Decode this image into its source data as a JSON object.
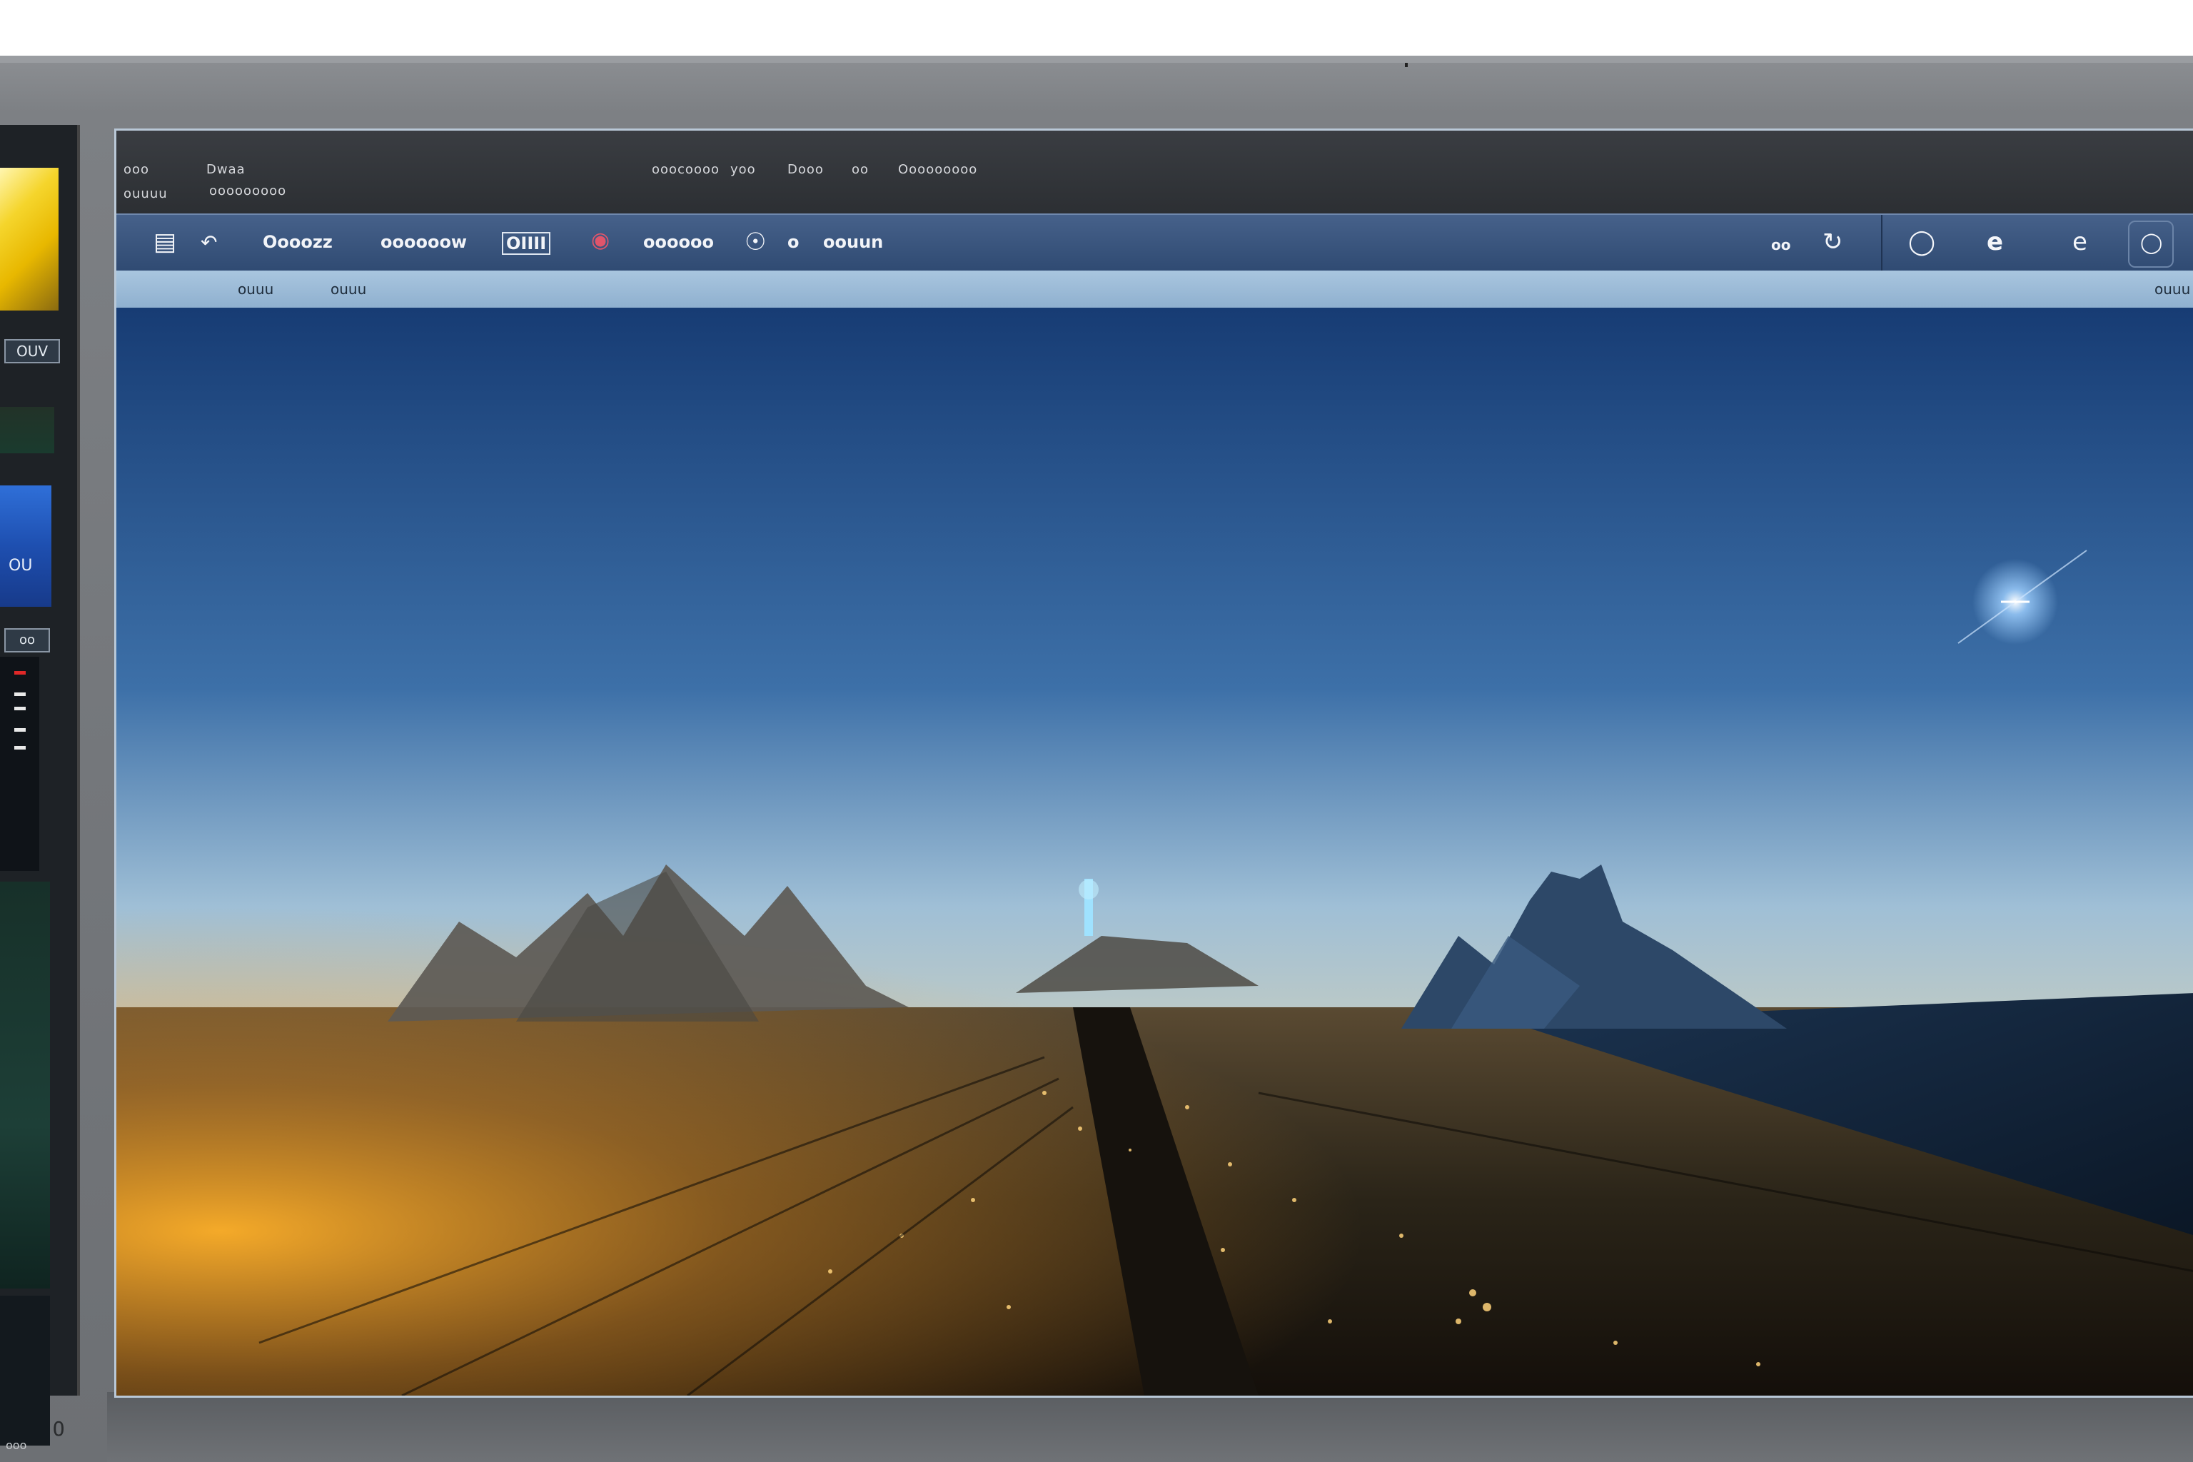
{
  "menubar": {
    "items": [
      "ooo",
      "Dwaa",
      "ouuuu",
      "ooooooooo",
      "ooocoooo",
      "yoo",
      "Dooo",
      "oo",
      "Ooooooooo"
    ]
  },
  "toolbar": {
    "items": [
      "Oooozz",
      "oooooow",
      "OIIII",
      "oooooo",
      "o",
      "oouun"
    ],
    "right_label": "oo",
    "icons": [
      "grid-icon",
      "back-icon",
      "record-icon",
      "location-pin-icon",
      "refresh-icon",
      "circle-icon",
      "e-icon",
      "e-icon",
      "circle-icon"
    ]
  },
  "subbar": {
    "items": [
      "ouuu",
      "ouuu",
      "ouuu"
    ]
  },
  "side_panel": {
    "labels": [
      "OUV",
      "OU",
      "oo"
    ],
    "foot": "ooo"
  },
  "bezel": {
    "label": "6 O"
  },
  "colors": {
    "toolbar": "#3a557e",
    "subbar": "#9bbad6",
    "sky_top": "#173c74",
    "horizon_glow": "#f5a623"
  }
}
